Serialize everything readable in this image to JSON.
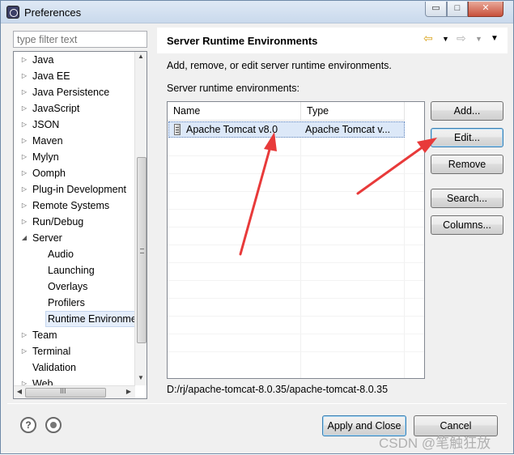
{
  "window": {
    "title": "Preferences",
    "controls": {
      "minimize": "▭",
      "maximize": "□",
      "close": "✕"
    }
  },
  "sidebar": {
    "filter_placeholder": "type filter text",
    "items": [
      {
        "label": "Java",
        "level": 0,
        "arrow": "▷"
      },
      {
        "label": "Java EE",
        "level": 0,
        "arrow": "▷"
      },
      {
        "label": "Java Persistence",
        "level": 0,
        "arrow": "▷"
      },
      {
        "label": "JavaScript",
        "level": 0,
        "arrow": "▷"
      },
      {
        "label": "JSON",
        "level": 0,
        "arrow": "▷"
      },
      {
        "label": "Maven",
        "level": 0,
        "arrow": "▷"
      },
      {
        "label": "Mylyn",
        "level": 0,
        "arrow": "▷"
      },
      {
        "label": "Oomph",
        "level": 0,
        "arrow": "▷"
      },
      {
        "label": "Plug-in Development",
        "level": 0,
        "arrow": "▷"
      },
      {
        "label": "Remote Systems",
        "level": 0,
        "arrow": "▷"
      },
      {
        "label": "Run/Debug",
        "level": 0,
        "arrow": "▷"
      },
      {
        "label": "Server",
        "level": 0,
        "arrow": "◢"
      },
      {
        "label": "Audio",
        "level": 1,
        "arrow": ""
      },
      {
        "label": "Launching",
        "level": 1,
        "arrow": ""
      },
      {
        "label": "Overlays",
        "level": 1,
        "arrow": ""
      },
      {
        "label": "Profilers",
        "level": 1,
        "arrow": ""
      },
      {
        "label": "Runtime Environme",
        "level": 1,
        "arrow": "",
        "selected": true
      },
      {
        "label": "Team",
        "level": 0,
        "arrow": "▷"
      },
      {
        "label": "Terminal",
        "level": 0,
        "arrow": "▷"
      },
      {
        "label": "Validation",
        "level": 0,
        "arrow": ""
      },
      {
        "label": "Web",
        "level": 0,
        "arrow": "▷"
      }
    ],
    "scroll": {
      "up": "▲",
      "down": "▼",
      "left": "◀",
      "right": "▶",
      "grip": "III"
    }
  },
  "page": {
    "title": "Server Runtime Environments",
    "description": "Add, remove, or edit server runtime environments.",
    "list_label": "Server runtime environments:",
    "nav": {
      "back": "⇦",
      "forward": "⇨",
      "dropdown": "▼",
      "menu": "▼"
    },
    "table": {
      "columns": [
        "Name",
        "Type"
      ],
      "rows": [
        {
          "name": "Apache Tomcat v8.0",
          "type": "Apache Tomcat v...",
          "selected": true
        }
      ]
    },
    "buttons": {
      "add": "Add...",
      "edit": "Edit...",
      "remove": "Remove",
      "search": "Search...",
      "columns": "Columns..."
    },
    "location": "D:/rj/apache-tomcat-8.0.35/apache-tomcat-8.0.35"
  },
  "footer": {
    "help_icon": "?",
    "apply_close": "Apply and Close",
    "cancel": "Cancel"
  },
  "watermark": "CSDN @笔触狂放",
  "colors": {
    "annotation_arrow": "#e83a3a",
    "selection": "#dce8f8"
  }
}
